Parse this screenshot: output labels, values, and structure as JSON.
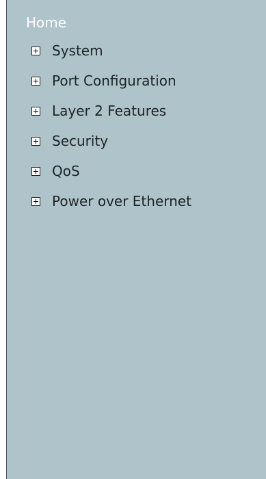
{
  "nav": {
    "home_label": "Home",
    "items": [
      {
        "label": "System",
        "icon": "expand-plus-icon"
      },
      {
        "label": "Port Configuration",
        "icon": "expand-plus-icon"
      },
      {
        "label": "Layer 2 Features",
        "icon": "expand-plus-icon"
      },
      {
        "label": "Security",
        "icon": "expand-plus-icon"
      },
      {
        "label": "QoS",
        "icon": "expand-plus-icon"
      },
      {
        "label": "Power over Ethernet",
        "icon": "expand-plus-icon"
      }
    ]
  },
  "colors": {
    "panel_background": "#afc3ca",
    "home_text": "#ffffff",
    "menu_text": "#1d2326",
    "panel_border": "#4e5a60"
  }
}
